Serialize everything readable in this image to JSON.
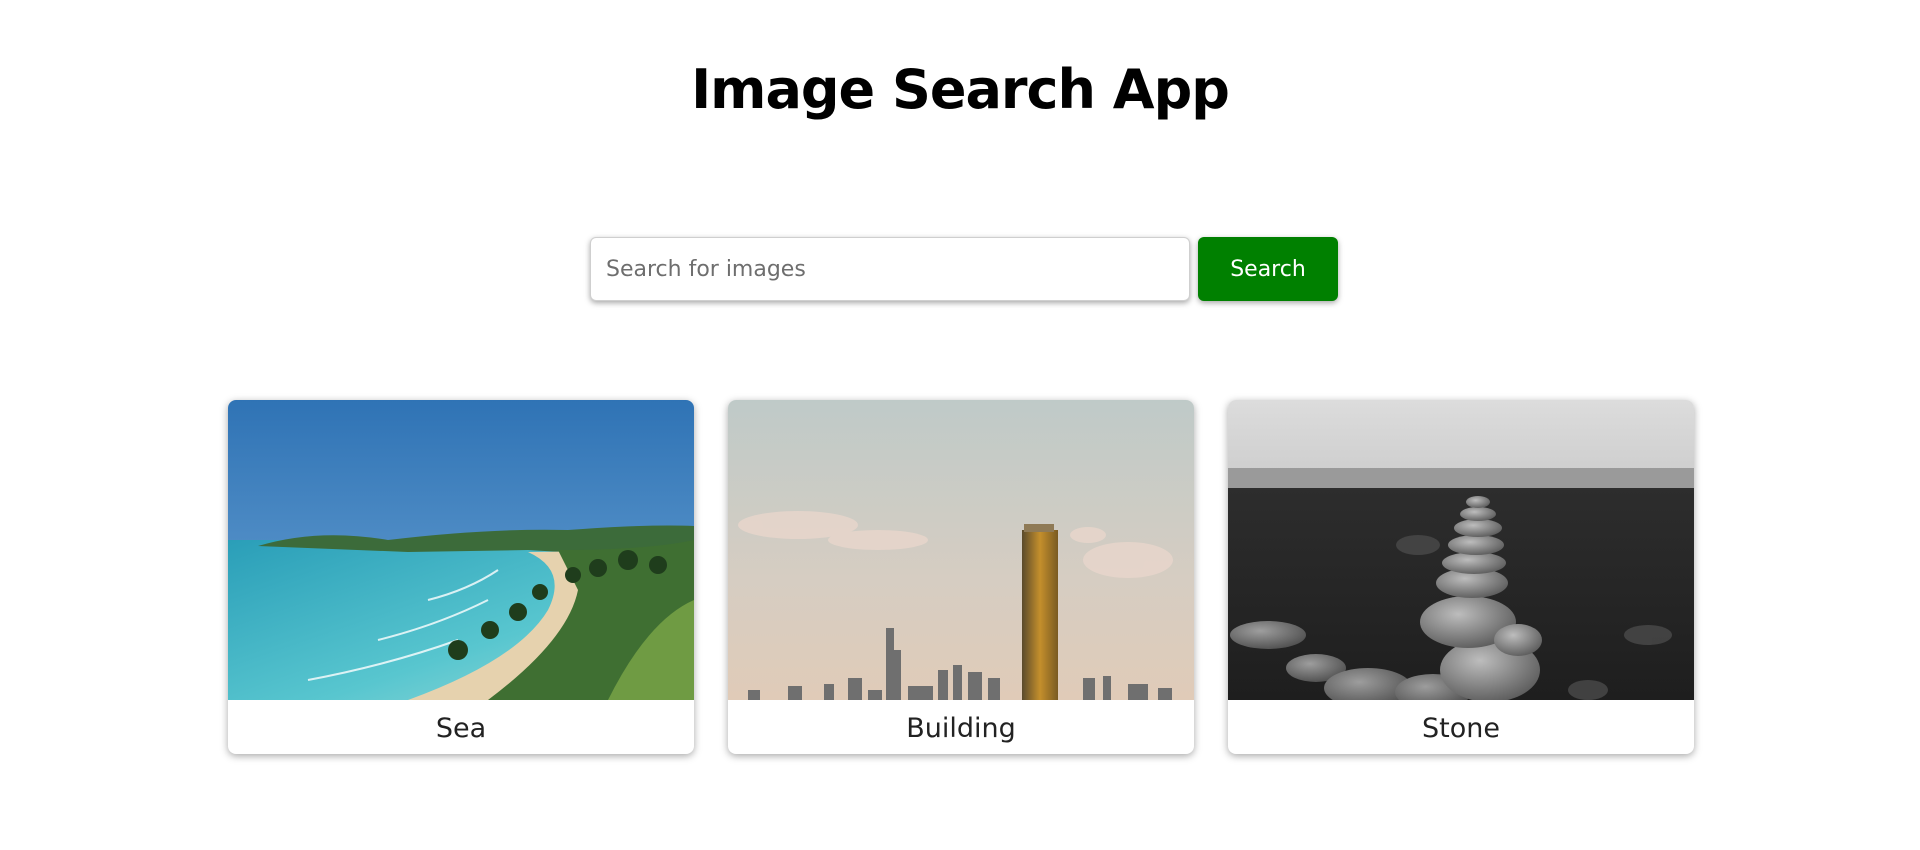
{
  "app": {
    "title": "Image Search App"
  },
  "search": {
    "placeholder": "Search for images",
    "value": "",
    "button_label": "Search",
    "button_color": "#008000"
  },
  "results": [
    {
      "caption": "Sea",
      "image": "beach-coastline-with-palm-trees"
    },
    {
      "caption": "Building",
      "image": "city-skyline-with-tall-tower"
    },
    {
      "caption": "Stone",
      "image": "stacked-stones-black-and-white"
    }
  ]
}
